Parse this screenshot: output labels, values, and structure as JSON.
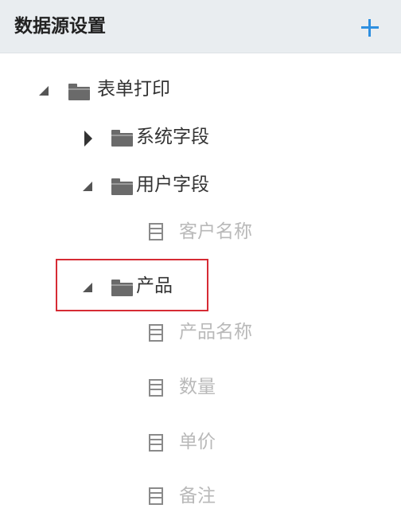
{
  "header": {
    "title": "数据源设置",
    "add_icon": "plus-icon"
  },
  "tree": {
    "root": {
      "label": "表单打印",
      "state": "expanded",
      "children": {
        "system_fields": {
          "label": "系统字段",
          "state": "collapsed"
        },
        "user_fields": {
          "label": "用户字段",
          "state": "expanded",
          "fields": [
            "客户名称"
          ]
        },
        "product": {
          "label": "产品",
          "state": "expanded",
          "selected": true,
          "fields": [
            "产品名称",
            "数量",
            "单价",
            "备注"
          ]
        }
      }
    }
  },
  "colors": {
    "accent": "#2e8fe0",
    "selection": "#d62b34",
    "header_bg": "#e9edf0",
    "field_text": "#b9b9b9"
  }
}
